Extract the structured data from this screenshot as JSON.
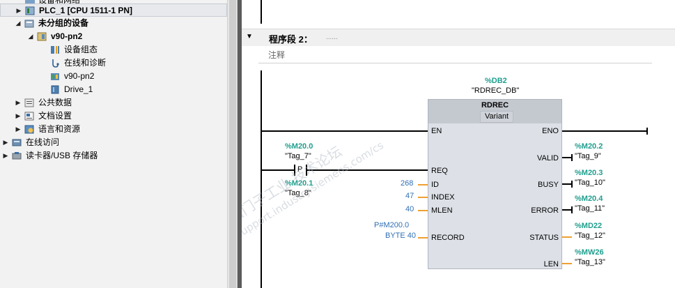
{
  "tree": {
    "items": [
      {
        "label": "设备和网络",
        "twisty": ""
      },
      {
        "label": "PLC_1 [CPU 1511-1 PN]",
        "twisty": "▶",
        "icon": "plc-icon",
        "bold": true
      },
      {
        "label": "未分组的设备",
        "twisty": "◢",
        "icon": "folder-icon",
        "bold": true
      },
      {
        "label": "v90-pn2",
        "twisty": "◢",
        "icon": "device-icon",
        "bold": true
      },
      {
        "label": "设备组态",
        "twisty": "",
        "icon": "device-config-icon"
      },
      {
        "label": "在线和诊断",
        "twisty": "",
        "icon": "diagnostics-icon"
      },
      {
        "label": "v90-pn2",
        "twisty": "",
        "icon": "drive-device-icon"
      },
      {
        "label": "Drive_1",
        "twisty": "",
        "icon": "drive-icon"
      },
      {
        "label": "公共数据",
        "twisty": "▶",
        "icon": "common-data-icon"
      },
      {
        "label": "文档设置",
        "twisty": "▶",
        "icon": "document-settings-icon"
      },
      {
        "label": "语言和资源",
        "twisty": "▶",
        "icon": "language-icon"
      },
      {
        "label": "在线访问",
        "twisty": "▶",
        "icon": "online-access-icon"
      },
      {
        "label": "读卡器/USB 存储器",
        "twisty": "▶",
        "icon": "card-reader-icon"
      }
    ]
  },
  "network": {
    "title": "程序段 2：",
    "title_dots": "......",
    "comment": "注释"
  },
  "block": {
    "db_address": "%DB2",
    "db_name": "\"RDREC_DB\"",
    "name": "RDREC",
    "variant": "Variant",
    "pins": {
      "en": "EN",
      "eno": "ENO",
      "req": "REQ",
      "id": "ID",
      "index": "INDEX",
      "mlen": "MLEN",
      "record": "RECORD",
      "valid": "VALID",
      "busy": "BUSY",
      "error": "ERROR",
      "status": "STATUS",
      "len": "LEN"
    },
    "inputs": {
      "req_contact": "P",
      "req_top_addr": "%M20.0",
      "req_top_tag": "\"Tag_7\"",
      "req_bot_addr": "%M20.1",
      "req_bot_tag": "\"Tag_8\"",
      "id_value": "268",
      "index_value": "47",
      "mlen_value": "40",
      "record_value_1": "P#M200.0",
      "record_value_2": "BYTE 40"
    },
    "outputs": {
      "valid_addr": "%M20.2",
      "valid_tag": "\"Tag_9\"",
      "busy_addr": "%M20.3",
      "busy_tag": "\"Tag_10\"",
      "error_addr": "%M20.4",
      "error_tag": "\"Tag_11\"",
      "status_addr": "%MD22",
      "status_tag": "\"Tag_12\"",
      "len_addr": "%MW26",
      "len_tag": "\"Tag_13\""
    }
  },
  "colors": {
    "address": "#1e9e8e",
    "constant": "#2f6fb5",
    "wire_param": "#f0a030",
    "block_body": "#dde1e7",
    "block_header": "#c4c8cf",
    "splitter": "#5b5b5b"
  }
}
